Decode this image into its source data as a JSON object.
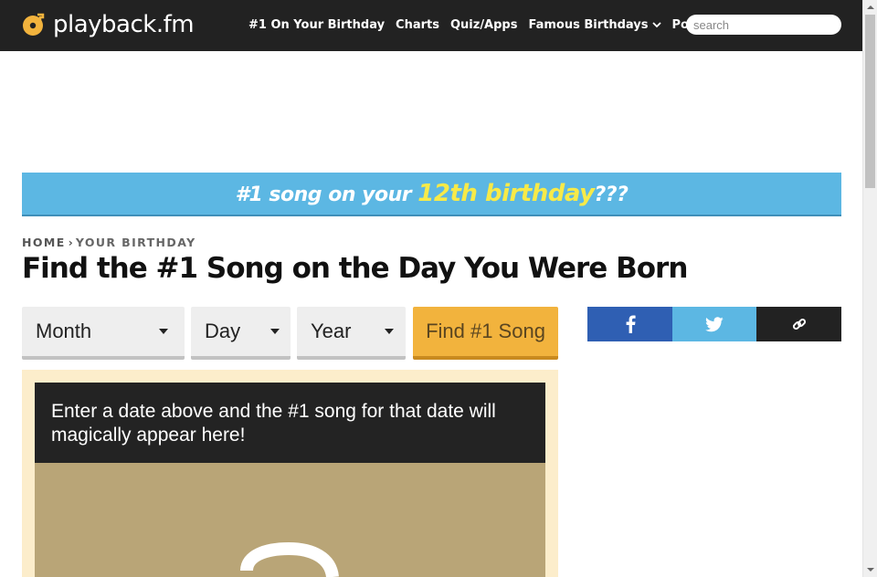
{
  "brand": {
    "name": "playback.fm",
    "accent": "#f2b33d"
  },
  "nav": {
    "items": [
      {
        "label": "#1 On Your Birthday",
        "dropdown": false
      },
      {
        "label": "Charts",
        "dropdown": false
      },
      {
        "label": "Quiz/Apps",
        "dropdown": false
      },
      {
        "label": "Famous Birthdays",
        "dropdown": true
      },
      {
        "label": "Popular",
        "dropdown": true
      }
    ],
    "search_placeholder": "search"
  },
  "banner": {
    "prefix": "#1 song on your ",
    "highlight": "12th birthday",
    "suffix": "???",
    "bg_color": "#5cb7e3",
    "highlight_color": "#f7ea48"
  },
  "breadcrumb": {
    "home": "HOME",
    "separator": "›",
    "current": "YOUR BIRTHDAY"
  },
  "page": {
    "title": "Find the #1 Song on the Day You Were Born"
  },
  "form": {
    "month_label": "Month",
    "day_label": "Day",
    "year_label": "Year",
    "submit_label": "Find #1 Song"
  },
  "share": {
    "buttons": [
      {
        "name": "facebook",
        "icon": "facebook-icon",
        "color": "#2f5fb3"
      },
      {
        "name": "twitter",
        "icon": "twitter-icon",
        "color": "#5cb7e3"
      },
      {
        "name": "copy-link",
        "icon": "link-icon",
        "color": "#222222"
      }
    ]
  },
  "result": {
    "message": "Enter a date above and the #1 song for that date will magically appear here!"
  }
}
